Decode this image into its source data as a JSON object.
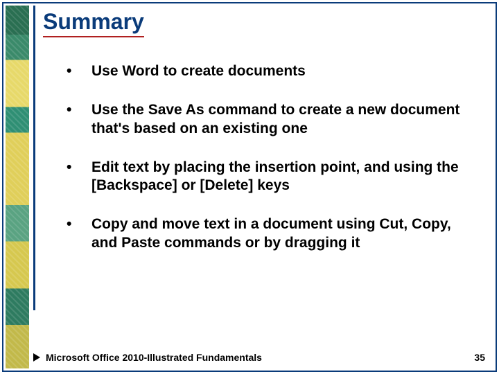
{
  "title": "Summary",
  "bullets": [
    "Use Word to create documents",
    "Use the Save As command to create a new document that's based on an existing one",
    "Edit text by placing the insertion point, and using the [Backspace] or [Delete] keys",
    "Copy and move text in a document using Cut, Copy, and Paste commands or by dragging it"
  ],
  "footer_text": "Microsoft Office 2010-Illustrated Fundamentals",
  "page_number": "35"
}
